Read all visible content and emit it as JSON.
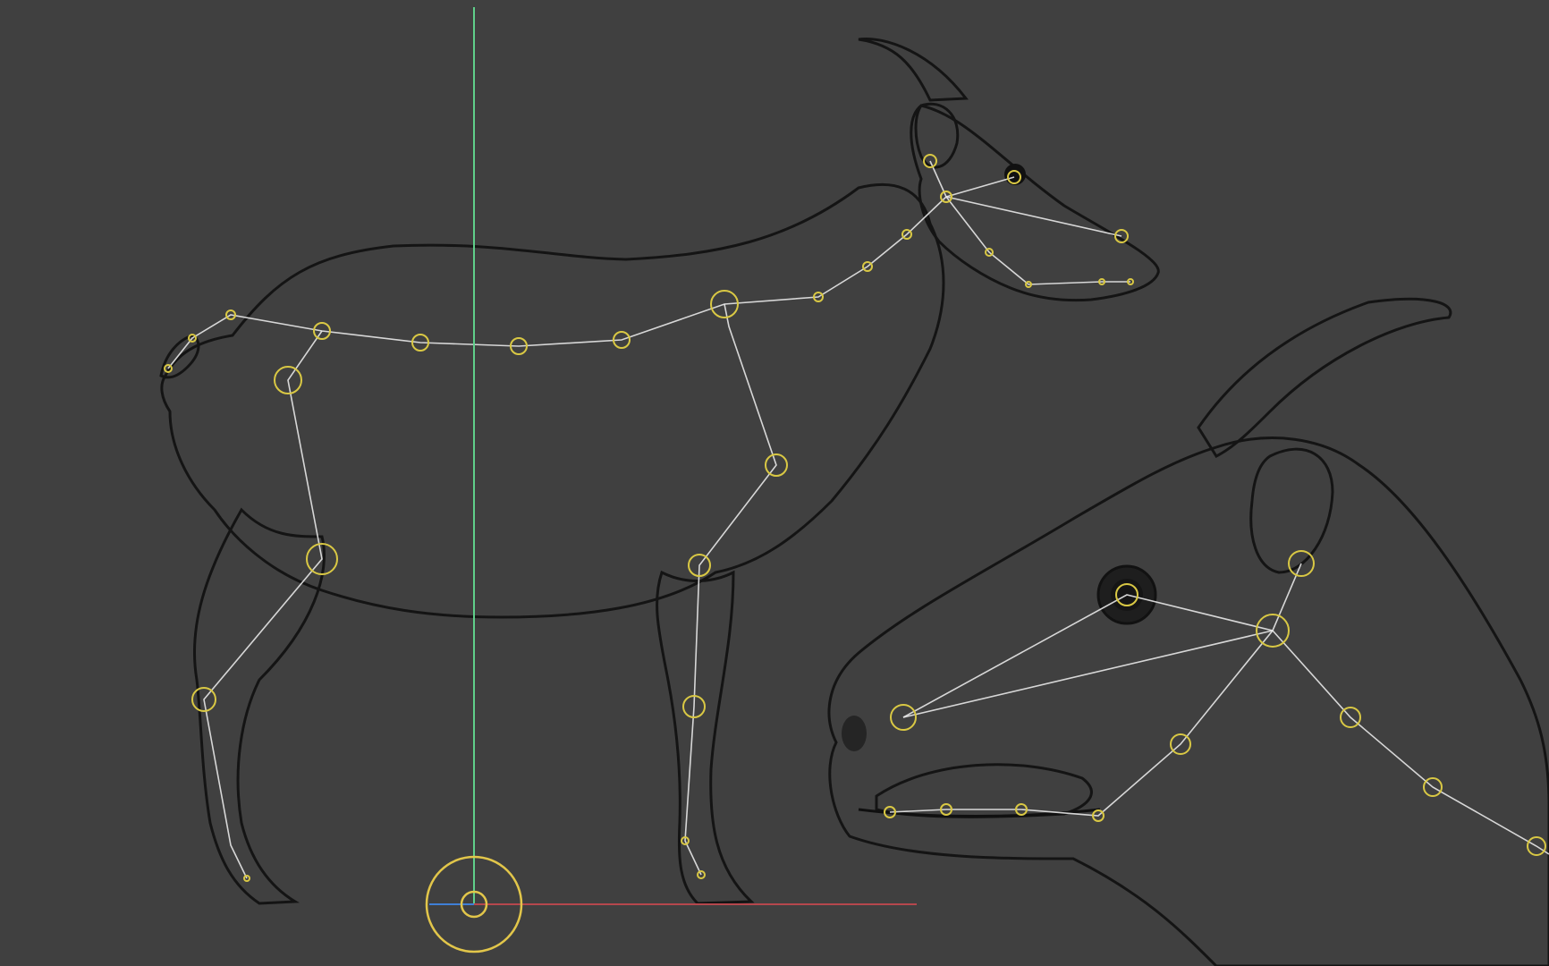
{
  "viewport": {
    "background_color": "#404040",
    "views": [
      {
        "name": "side-view",
        "subject": "goat-rig-wireframe"
      },
      {
        "name": "head-closeup",
        "subject": "goat-head-rig-wireframe"
      }
    ]
  },
  "colors": {
    "mesh_fill": "#353535",
    "mesh_wire": "#141414",
    "bone": "#e8e8e8",
    "joint_ring": "#d9c844",
    "axis_x": "#b5474d",
    "axis_y": "#5fcf8a",
    "axis_z": "#3f7fd6",
    "gizmo": "#e2c64a"
  },
  "icons": {
    "world_gizmo": "origin-gizmo-icon",
    "axis_x": "x-axis-line",
    "axis_y": "y-axis-line"
  }
}
